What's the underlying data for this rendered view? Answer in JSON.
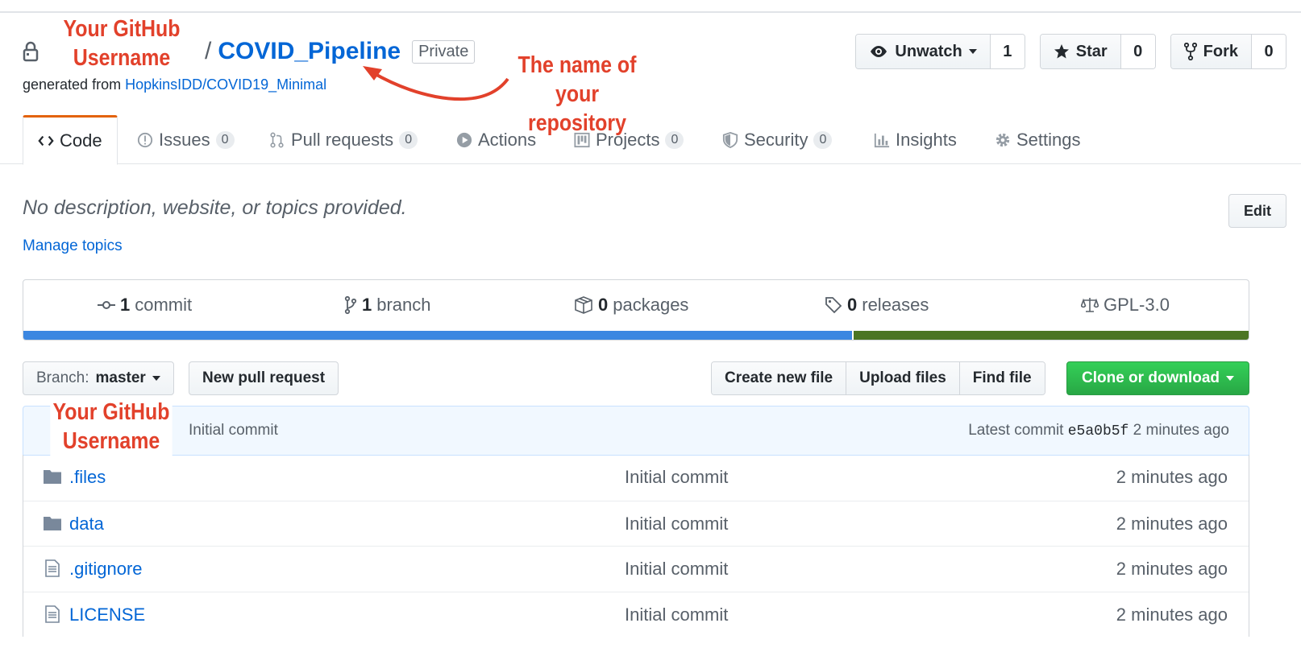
{
  "repo": {
    "slash": "/",
    "name": "COVID_Pipeline",
    "visibility": "Private",
    "generated_prefix": "generated from",
    "template_link": "HopkinsIDD/COVID19_Minimal"
  },
  "actions": {
    "watch": {
      "label": "Unwatch",
      "count": "1"
    },
    "star": {
      "label": "Star",
      "count": "0"
    },
    "fork": {
      "label": "Fork",
      "count": "0"
    }
  },
  "tabs": [
    {
      "label": "Code",
      "icon": "code-icon"
    },
    {
      "label": "Issues",
      "count": "0",
      "icon": "issue-icon"
    },
    {
      "label": "Pull requests",
      "count": "0",
      "icon": "pull-request-icon"
    },
    {
      "label": "Actions",
      "icon": "play-icon"
    },
    {
      "label": "Projects",
      "count": "0",
      "icon": "project-icon"
    },
    {
      "label": "Security",
      "count": "0",
      "icon": "shield-icon"
    },
    {
      "label": "Insights",
      "icon": "graph-icon"
    },
    {
      "label": "Settings",
      "icon": "gear-icon"
    }
  ],
  "description": {
    "text": "No description, website, or topics provided.",
    "manage_topics": "Manage topics",
    "edit": "Edit"
  },
  "summary": {
    "commits": {
      "count": "1",
      "label": "commit"
    },
    "branches": {
      "count": "1",
      "label": "branch"
    },
    "packages": {
      "count": "0",
      "label": "packages"
    },
    "releases": {
      "count": "0",
      "label": "releases"
    },
    "license": "GPL-3.0",
    "language_colors": [
      "#3b87e1",
      "#4b7524"
    ]
  },
  "file_nav": {
    "branch_prefix": "Branch:",
    "branch": "master",
    "new_pr": "New pull request",
    "create_file": "Create new file",
    "upload": "Upload files",
    "find": "Find file",
    "clone": "Clone or download"
  },
  "commit": {
    "message": "Initial commit",
    "latest_prefix": "Latest commit",
    "sha": "e5a0b5f",
    "age": "2 minutes ago"
  },
  "files": [
    {
      "name": ".files",
      "type": "folder",
      "message": "Initial commit",
      "age": "2 minutes ago"
    },
    {
      "name": "data",
      "type": "folder",
      "message": "Initial commit",
      "age": "2 minutes ago"
    },
    {
      "name": ".gitignore",
      "type": "file",
      "message": "Initial commit",
      "age": "2 minutes ago"
    },
    {
      "name": "LICENSE",
      "type": "file",
      "message": "Initial commit",
      "age": "2 minutes ago"
    }
  ],
  "annotations": {
    "username_top": [
      "Your GitHub",
      "Username"
    ],
    "repo_name": [
      "The name of your",
      "repository"
    ],
    "username_bottom": [
      "Your GitHub",
      "Username"
    ],
    "color": "#e2412b"
  }
}
